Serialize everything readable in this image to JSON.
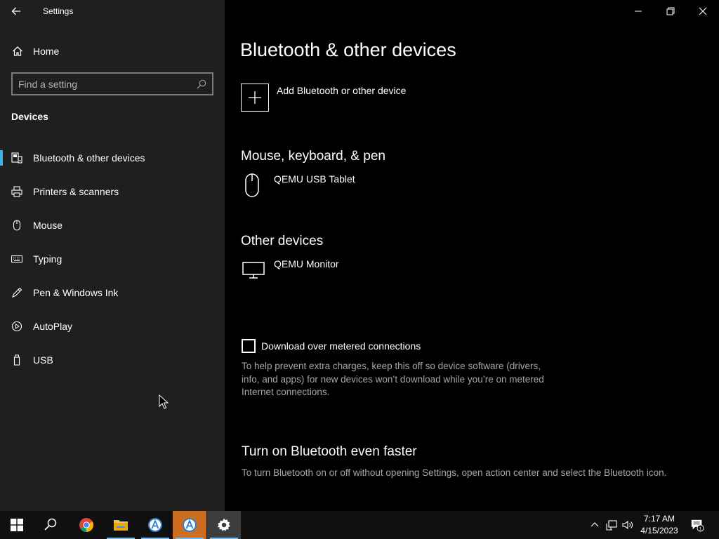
{
  "window": {
    "app_title": "Settings"
  },
  "sidebar": {
    "home_label": "Home",
    "search_placeholder": "Find a setting",
    "section_title": "Devices",
    "items": [
      {
        "label": "Bluetooth & other devices",
        "icon": "bluetooth-devices-icon",
        "active": true
      },
      {
        "label": "Printers & scanners",
        "icon": "printer-icon"
      },
      {
        "label": "Mouse",
        "icon": "mouse-icon"
      },
      {
        "label": "Typing",
        "icon": "keyboard-icon"
      },
      {
        "label": "Pen & Windows Ink",
        "icon": "pen-icon"
      },
      {
        "label": "AutoPlay",
        "icon": "autoplay-icon"
      },
      {
        "label": "USB",
        "icon": "usb-icon"
      }
    ]
  },
  "main": {
    "title": "Bluetooth & other devices",
    "add_device_label": "Add Bluetooth or other device",
    "groups": [
      {
        "title": "Mouse, keyboard, & pen",
        "devices": [
          {
            "name": "QEMU USB Tablet",
            "icon": "mouse-icon"
          }
        ]
      },
      {
        "title": "Other devices",
        "devices": [
          {
            "name": "QEMU Monitor",
            "icon": "monitor-icon"
          }
        ]
      }
    ],
    "metered": {
      "label": "Download over metered connections",
      "checked": false,
      "help": "To help prevent extra charges, keep this off so device software (drivers, info, and apps) for new devices won’t download while you’re on metered Internet connections."
    },
    "bt_faster": {
      "title": "Turn on Bluetooth even faster",
      "help": "To turn Bluetooth on or off without opening Settings, open action center and select the Bluetooth icon."
    }
  },
  "taskbar": {
    "apps": [
      "start",
      "search",
      "chrome",
      "file-explorer",
      "app-a",
      "app-a-active",
      "settings"
    ],
    "clock_time": "7:17 AM",
    "clock_date": "4/15/2023",
    "notification_count": "1"
  },
  "colors": {
    "accent": "#3cb4e6",
    "sidebar_bg": "#1f1f1f",
    "main_bg": "#000000",
    "taskbar_bg": "#101010"
  }
}
